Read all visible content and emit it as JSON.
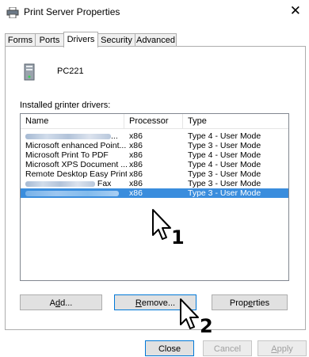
{
  "window": {
    "title": "Print Server Properties",
    "close_label": "✕"
  },
  "tabs": [
    {
      "label": "Forms"
    },
    {
      "label": "Ports"
    },
    {
      "label": "Drivers"
    },
    {
      "label": "Security"
    },
    {
      "label": "Advanced"
    }
  ],
  "active_tab": "Drivers",
  "server": {
    "name": "PC221"
  },
  "drivers": {
    "label_pre": "Installed ",
    "label_key": "p",
    "label_post": "rinter drivers:",
    "columns": [
      "Name",
      "Processor",
      "Type"
    ],
    "rows": [
      {
        "name": "...",
        "name_redacted": true,
        "processor": "x86",
        "type": "Type 4 - User Mode"
      },
      {
        "name": "Microsoft enhanced Point...",
        "processor": "x86",
        "type": "Type 3 - User Mode"
      },
      {
        "name": "Microsoft Print To PDF",
        "processor": "x86",
        "type": "Type 4 - User Mode"
      },
      {
        "name": "Microsoft XPS Document ...",
        "processor": "x86",
        "type": "Type 4 - User Mode"
      },
      {
        "name": "Remote Desktop Easy Print",
        "processor": "x86",
        "type": "Type 3 - User Mode"
      },
      {
        "name": "Fax",
        "name_redacted": true,
        "processor": "x86",
        "type": "Type 3 - User Mode"
      },
      {
        "name": "",
        "name_redacted": true,
        "processor": "x86",
        "type": "Type 3 - User Mode",
        "selected": true
      }
    ]
  },
  "buttons": {
    "add": {
      "pre": "A",
      "key": "d",
      "post": "d..."
    },
    "remove": {
      "pre": "",
      "key": "R",
      "post": "emove..."
    },
    "properties": {
      "pre": "Prop",
      "key": "e",
      "post": "rties"
    },
    "close": "Close",
    "cancel": "Cancel",
    "apply": {
      "pre": "",
      "key": "A",
      "post": "pply"
    }
  },
  "annotations": {
    "step1": "1",
    "step2": "2"
  }
}
